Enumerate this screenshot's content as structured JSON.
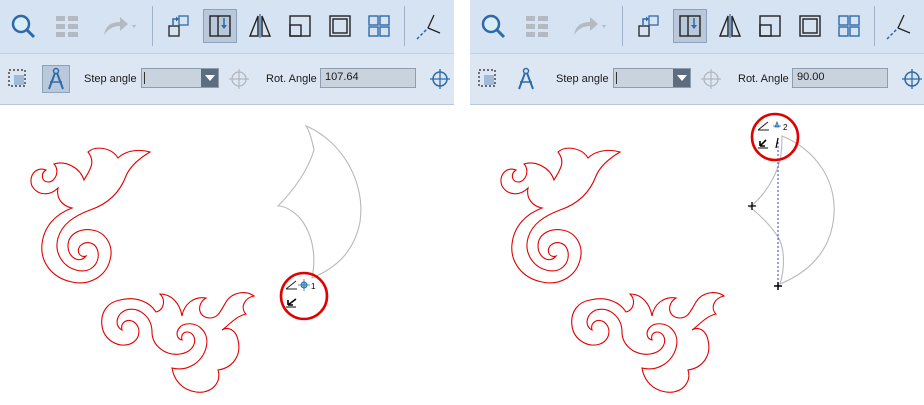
{
  "panels": [
    {
      "id": "before",
      "step_angle": {
        "label": "Step angle",
        "value": ""
      },
      "rot_angle": {
        "label": "Rot. Angle",
        "value": "107.64"
      },
      "cursor_label": "1"
    },
    {
      "id": "after",
      "step_angle": {
        "label": "Step angle",
        "value": ""
      },
      "rot_angle": {
        "label": "Rot. Angle",
        "value": "90.00"
      },
      "cursor_label": "2"
    }
  ],
  "icons": {
    "zoom": "magnifier-icon",
    "grid": "grid-icon",
    "redo": "redo-arrow-icon",
    "ungroup": "move-to-corner-icon",
    "flip_vertical": "split-rectangle-icon",
    "mirror": "mirror-triangle-icon",
    "corner_square": "corner-square-icon",
    "frame": "square-frame-icon",
    "four_squares": "four-squares-icon",
    "angle": "angle-line-icon",
    "select_box": "dotted-select-icon",
    "compass": "compass-icon",
    "crosshair": "crosshair-icon"
  },
  "colors": {
    "toolbar_bg": "#d6e3f2",
    "embroidery_red": "#e00000",
    "highlight_circle": "#e00000",
    "grey_shape": "#b8b8b8",
    "guide_line": "#3a3ad0"
  }
}
